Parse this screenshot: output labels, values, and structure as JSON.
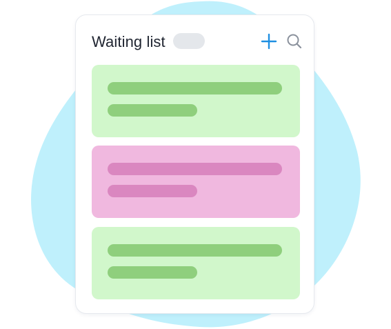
{
  "header": {
    "title": "Waiting list"
  },
  "colors": {
    "blob": "#bff0fc",
    "card_background": "#ffffff",
    "pill": "#e4e7eb",
    "accent": "#1e8fe1",
    "search_icon": "#8a919c",
    "green_item": "#d1f7cb",
    "green_line": "#8fcf7d",
    "pink_item": "#f0b8df",
    "pink_line": "#da87c0"
  },
  "icons": {
    "add": "plus-icon",
    "search": "search-icon"
  },
  "list_items": [
    {
      "variant": "green"
    },
    {
      "variant": "pink"
    },
    {
      "variant": "green"
    }
  ]
}
